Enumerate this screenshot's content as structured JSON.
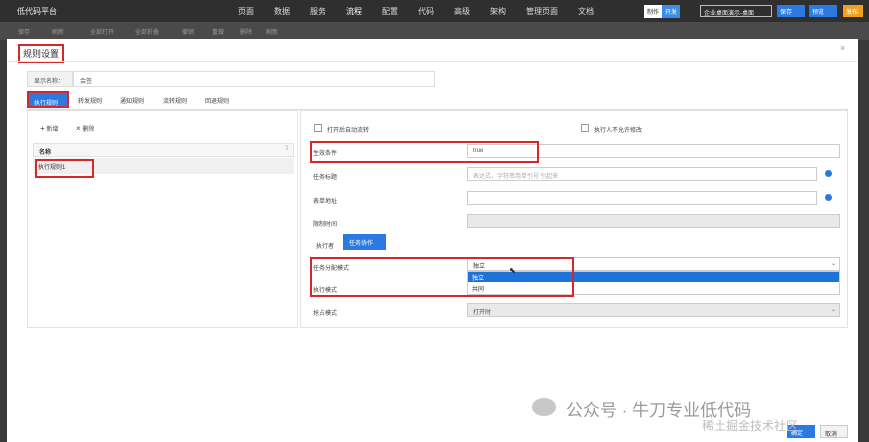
{
  "topbar": {
    "brand": "低代码平台",
    "nav": [
      "页面",
      "数据",
      "服务",
      "流程",
      "配置",
      "代码",
      "高级",
      "架构",
      "管理页面",
      "文档"
    ],
    "active_nav": "流程",
    "mode": [
      "制作",
      "开发"
    ],
    "tenant_select": "企业桌面演示-桌面",
    "btn1": "保存",
    "btn2": "预览",
    "btn3": "发布"
  },
  "toolbar2": [
    "保存",
    "刷新",
    "全部打开",
    "全部折叠",
    "撤销",
    "重做",
    "删除",
    "刷新"
  ],
  "modal": {
    "title": "规则设置",
    "close": "×",
    "display_name_label": "显示名称：",
    "display_name_value": "会签",
    "tabs": [
      "执行规则",
      "转发规则",
      "通知规则",
      "流转规则",
      "回退规则"
    ],
    "left": {
      "add_label": "新增",
      "delete_label": "删除",
      "col_name": "名称",
      "rows": [
        "执行规则1"
      ]
    },
    "right": {
      "auto_flow_label": "打开后自动流转",
      "no_modify_label": "执行人不允许修改",
      "condition_label": "生效条件",
      "condition_value": "true",
      "task_title_label": "任务标题",
      "task_title_placeholder": "表达式，字符串用单引号'引起来",
      "form_url_label": "表单地址",
      "form_url_value": "",
      "limit_time_label": "限制时间",
      "subtab_executor": "执行者",
      "subtab_task_action": "任务协作",
      "assign_mode_label": "任务分配模式",
      "assign_mode_value": "独立",
      "assign_options": [
        "独立",
        "共同"
      ],
      "exec_mode_label": "执行模式",
      "claim_mode_label": "抢占模式",
      "claim_mode_value": "打开时"
    },
    "footer": {
      "ok": "确定",
      "cancel": "取消"
    }
  },
  "watermark": {
    "main": "公众号 · 牛刀专业低代码",
    "sub": "稀土掘金技术社区"
  },
  "colors": {
    "accent": "#2a7ae2",
    "highlight": "#d62828",
    "topbar": "#2f2f2f"
  }
}
